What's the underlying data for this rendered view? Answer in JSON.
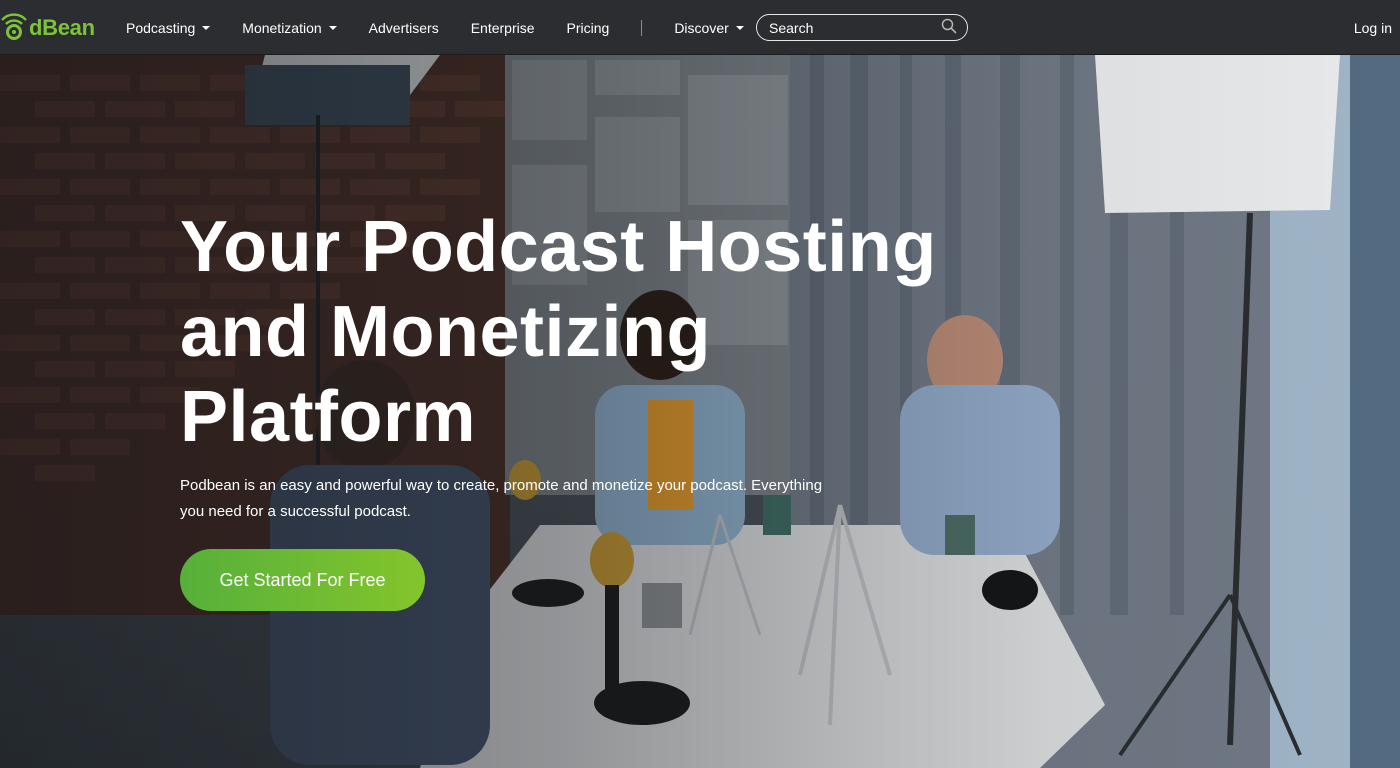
{
  "header": {
    "logo_text": "dBean",
    "logo_full": "PodBean",
    "nav": [
      {
        "label": "Podcasting",
        "has_dropdown": true
      },
      {
        "label": "Monetization",
        "has_dropdown": true
      },
      {
        "label": "Advertisers",
        "has_dropdown": false
      },
      {
        "label": "Enterprise",
        "has_dropdown": false
      },
      {
        "label": "Pricing",
        "has_dropdown": false
      },
      {
        "label": "Discover",
        "has_dropdown": true
      }
    ],
    "search_placeholder": "Search",
    "login_label": "Log in"
  },
  "hero": {
    "title_lines": [
      "Your Podcast Hosting",
      "and Monetizing",
      "Platform"
    ],
    "subtitle_line1": "Podbean is an easy and powerful way to create, promote and monetize your podcast. Everything",
    "subtitle_line2": "you need for a successful podcast.",
    "cta_label": "Get Started For Free"
  },
  "colors": {
    "brand_green": "#7cc339",
    "cta_gradient_start": "#56b03a",
    "cta_gradient_end": "#84c52c",
    "topbar_bg": "#2b2d30"
  },
  "icons": {
    "search": "search-icon",
    "logo": "podbean-logo-icon",
    "dropdown": "chevron-down-icon"
  }
}
